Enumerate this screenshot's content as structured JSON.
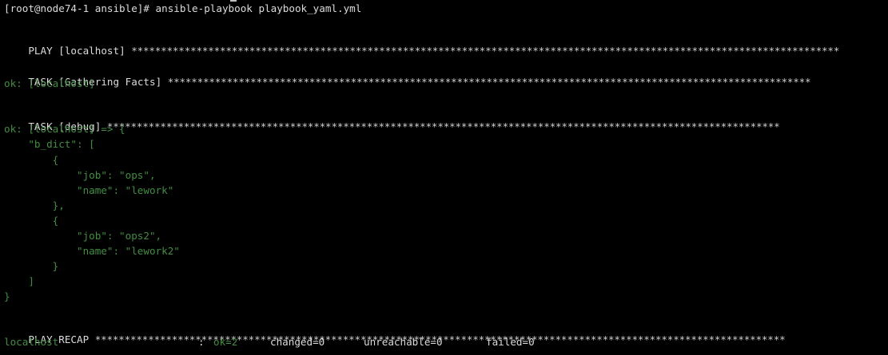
{
  "terminal": {
    "prompt": "[root@node74-1 ansible]# ansible-playbook playbook_yaml.yml",
    "play_header": "PLAY [localhost] ",
    "play_stars": "************************************************************************************************************************",
    "task1_header": "TASK [Gathering Facts] ",
    "task1_stars": "*************************************************************************************************************",
    "task1_result": "ok: [localhost]",
    "task2_header": "TASK [debug] ",
    "task2_stars": "******************************************************************************************************************",
    "task2_result": "ok: [localhost] => {",
    "json_lines": [
      "    \"b_dict\": [",
      "        {",
      "            \"job\": \"ops\",",
      "            \"name\": \"lework\"",
      "        },",
      "        {",
      "            \"job\": \"ops2\",",
      "            \"name\": \"lework2\"",
      "        }",
      "    ]",
      "}"
    ],
    "recap_header": "PLAY RECAP ",
    "recap_stars": "*********************************************************************************************************************",
    "recap": {
      "host": "localhost",
      "colon": ":",
      "ok": "ok=2",
      "changed": "changed=0",
      "unreachable": "unreachable=0",
      "failed": "failed=0"
    }
  },
  "colors": {
    "background": "#000000",
    "text": "#dcdcdc",
    "success_green": "#3f8f3f"
  }
}
